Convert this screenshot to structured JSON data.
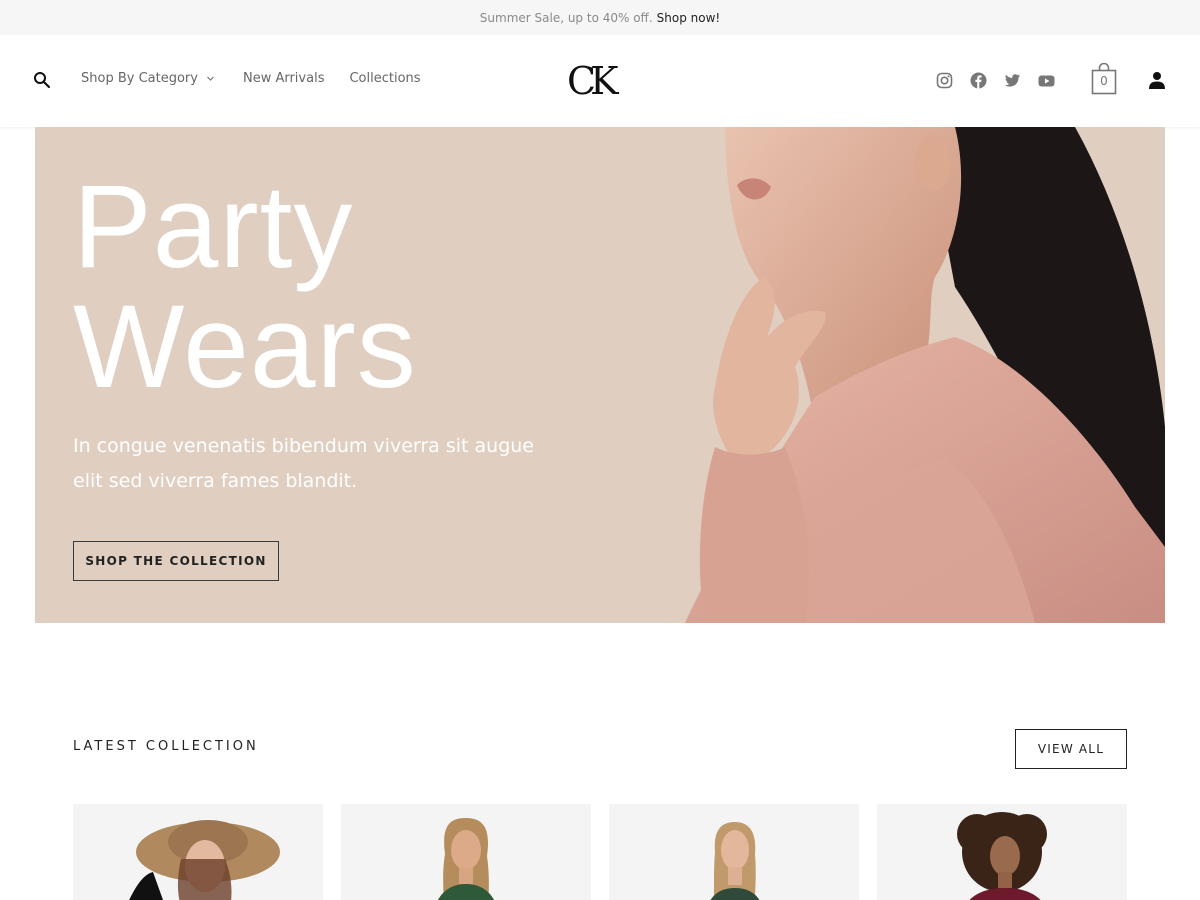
{
  "announcement": {
    "text": "Summer Sale, up to 40% off.",
    "link": "Shop now!"
  },
  "header": {
    "nav": [
      "Shop By Category",
      "New Arrivals",
      "Collections"
    ],
    "logo": "CK",
    "cart_count": "0",
    "social_icons": [
      "instagram-icon",
      "facebook-icon",
      "twitter-icon",
      "youtube-icon"
    ]
  },
  "hero": {
    "title_line1": "Party",
    "title_line2": "Wears",
    "text": "In congue venenatis bibendum viverra sit augue elit sed viverra fames blandit.",
    "button": "SHOP THE COLLECTION"
  },
  "latest": {
    "title": "LATEST COLLECTION",
    "view_all": "VIEW ALL"
  },
  "colors": {
    "hero_bg": "#e0cfc1",
    "topbar_bg": "#f6f6f6",
    "card_bg": "#f4f4f4"
  }
}
